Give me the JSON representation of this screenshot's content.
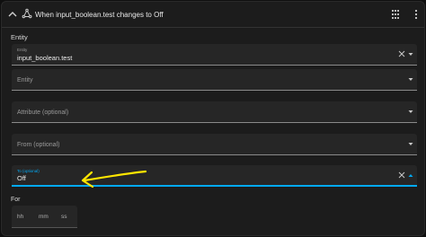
{
  "header": {
    "title": "When input_boolean.test changes to Off"
  },
  "entity_section": {
    "label": "Entity"
  },
  "fields": {
    "entity_selected": {
      "label": "Entity",
      "value": "input_boolean.test"
    },
    "entity_empty": {
      "placeholder": "Entity"
    },
    "attribute": {
      "placeholder": "Attribute (optional)"
    },
    "from": {
      "placeholder": "From (optional)"
    },
    "to": {
      "label": "To (optional)",
      "value": "Off"
    }
  },
  "for_section": {
    "label": "For",
    "hh": "hh",
    "mm": "mm",
    "ss": "ss"
  },
  "colors": {
    "accent": "#03a9f4",
    "annotation": "#ffe600"
  }
}
